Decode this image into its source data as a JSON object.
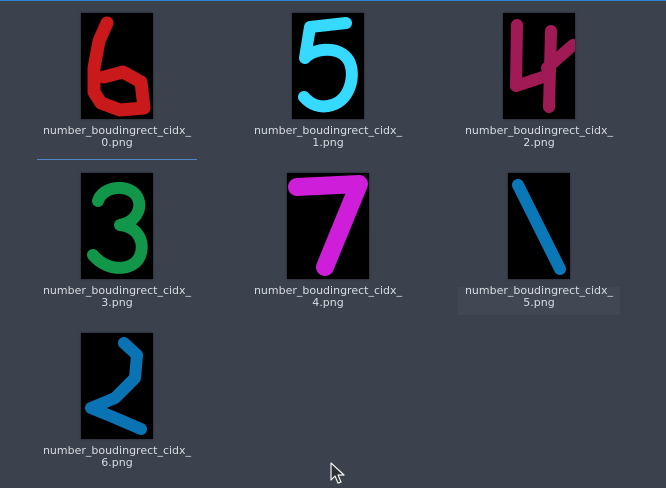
{
  "files": [
    {
      "name_line1": "number_boudingrect_cidx_",
      "name_line2": "0.png",
      "thumb_icon": "digit-6-red-icon",
      "color": "#c9191a"
    },
    {
      "name_line1": "number_boudingrect_cidx_",
      "name_line2": "1.png",
      "thumb_icon": "digit-5-cyan-icon",
      "color": "#36d9ff"
    },
    {
      "name_line1": "number_boudingrect_cidx_",
      "name_line2": "2.png",
      "thumb_icon": "digit-4-maroon-icon",
      "color": "#a01b56"
    },
    {
      "name_line1": "number_boudingrect_cidx_",
      "name_line2": "3.png",
      "thumb_icon": "digit-3-green-icon",
      "color": "#12964a"
    },
    {
      "name_line1": "number_boudingrect_cidx_",
      "name_line2": "4.png",
      "thumb_icon": "digit-7-magenta-icon",
      "color": "#cf1ed9"
    },
    {
      "name_line1": "number_boudingrect_cidx_",
      "name_line2": "5.png",
      "thumb_icon": "digit-1-blue-icon",
      "color": "#0a78b6"
    },
    {
      "name_line1": "number_boudingrect_cidx_",
      "name_line2": "6.png",
      "thumb_icon": "digit-2-blue-icon",
      "color": "#0a73b3"
    }
  ],
  "ui": {
    "accent": "#2f85d6",
    "cursor_icon": "mouse-pointer-icon"
  }
}
